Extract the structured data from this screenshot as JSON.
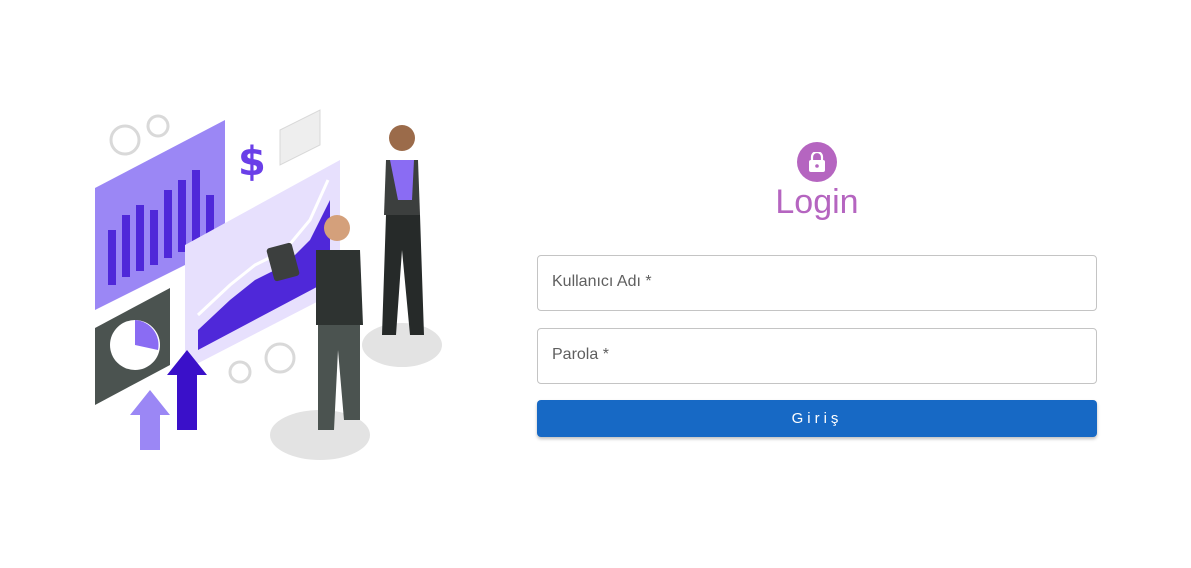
{
  "login": {
    "title": "Login",
    "icon": "lock-icon",
    "username_label": "Kullanıcı Adı",
    "password_label": "Parola",
    "required_marker": "*",
    "submit_label": "Giriş"
  },
  "illustration": {
    "currency_symbol": "$"
  },
  "colors": {
    "accent": "#b565c0",
    "primary_button": "#1769c5",
    "illustration_purple": "#7b5cf0"
  }
}
